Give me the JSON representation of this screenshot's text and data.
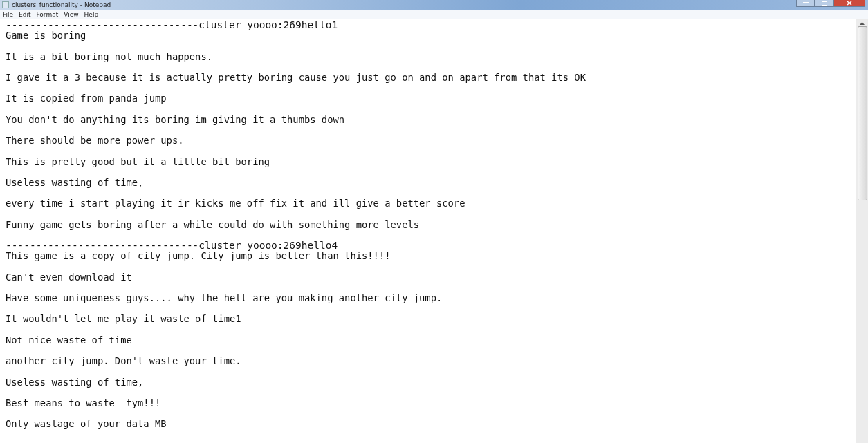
{
  "window": {
    "title": "clusters_functionality - Notepad"
  },
  "menu": [
    "File",
    "Edit",
    "Format",
    "View",
    "Help"
  ],
  "lines": [
    {
      "kind": "header",
      "text": "--------------------------------cluster yoooo:269hello1"
    },
    {
      "kind": "text",
      "text": "Game is boring"
    },
    {
      "kind": "text",
      "text": "It is a bit boring not much happens."
    },
    {
      "kind": "text",
      "text": "I gave it a 3 because it is actually pretty boring cause you just go on and on apart from that its OK"
    },
    {
      "kind": "text",
      "text": "It is copied from panda jump"
    },
    {
      "kind": "text",
      "text": "You don't do anything its boring im giving it a thumbs down"
    },
    {
      "kind": "text",
      "text": "There should be more power ups."
    },
    {
      "kind": "text",
      "text": "This is pretty good but it a little bit boring"
    },
    {
      "kind": "text",
      "text": "Useless wasting of time,"
    },
    {
      "kind": "text",
      "text": "every time i start playing it ir kicks me off fix it and ill give a better score"
    },
    {
      "kind": "text",
      "text": "Funny game gets boring after a while could do with something more levels"
    },
    {
      "kind": "header",
      "text": "--------------------------------cluster yoooo:269hello4"
    },
    {
      "kind": "text",
      "text": "This game is a copy of city jump. City jump is better than this!!!!"
    },
    {
      "kind": "text",
      "text": "Can't even download it"
    },
    {
      "kind": "text",
      "text": "Have some uniqueness guys.... why the hell are you making another city jump."
    },
    {
      "kind": "text",
      "text": "It wouldn't let me play it waste of time1"
    },
    {
      "kind": "text",
      "text": "Not nice waste of time"
    },
    {
      "kind": "text",
      "text": "another city jump. Don't waste your time."
    },
    {
      "kind": "text",
      "text": "Useless wasting of time,"
    },
    {
      "kind": "text",
      "text": "Best means to waste  tym!!!"
    },
    {
      "kind": "text",
      "text": "Only wastage of your data MB"
    }
  ]
}
